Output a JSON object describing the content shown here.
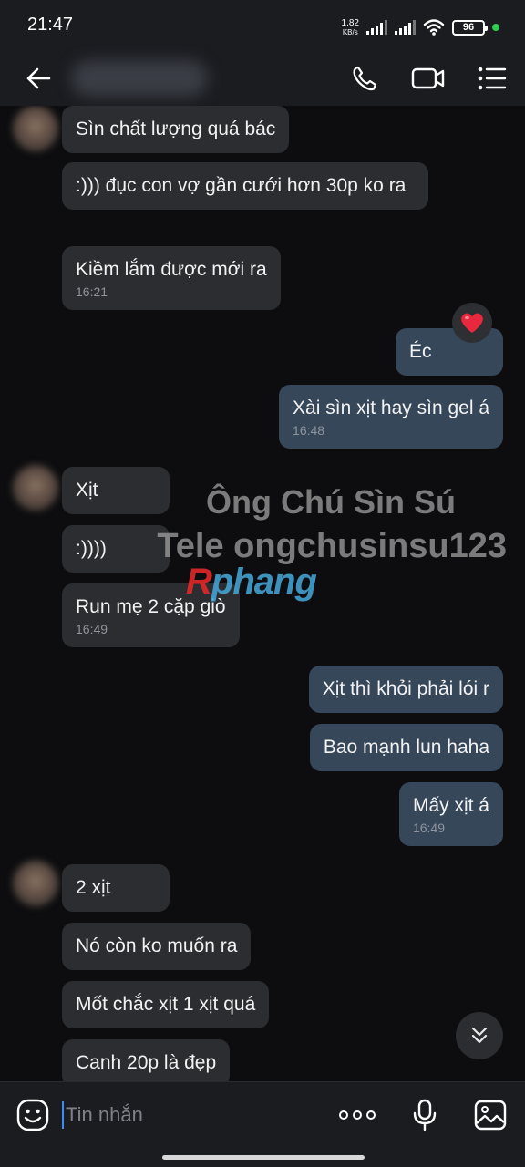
{
  "status_bar": {
    "time": "21:47",
    "net_speed_value": "1.82",
    "net_speed_unit": "KB/s",
    "battery": "96"
  },
  "header": {
    "contact_name": "",
    "icons": [
      "back-arrow-icon",
      "phone-icon",
      "video-call-icon",
      "menu-list-icon"
    ]
  },
  "messages": [
    {
      "side": "in",
      "text": "Sìn chất lượng quá bác"
    },
    {
      "side": "in",
      "text": ":))) đục con vợ gần cưới hơn 30p ko ra"
    },
    {
      "side": "in",
      "text": "Kiềm lắm được mới ra",
      "time": "16:21"
    },
    {
      "side": "out",
      "text": "Éc",
      "reaction": "heart"
    },
    {
      "side": "out",
      "text": "Xài sìn xịt hay sìn gel á",
      "time": "16:48"
    },
    {
      "side": "in",
      "text": "Xịt"
    },
    {
      "side": "in",
      "text": ":))))"
    },
    {
      "side": "in",
      "text": "Run mẹ 2 cặp giò",
      "time": "16:49"
    },
    {
      "side": "out",
      "text": "Xịt thì khỏi phải lói r"
    },
    {
      "side": "out",
      "text": "Bao mạnh lun haha"
    },
    {
      "side": "out",
      "text": "Mấy xịt á",
      "time": "16:49"
    },
    {
      "side": "in",
      "text": "2 xịt"
    },
    {
      "side": "in",
      "text": "Nó còn ko muốn ra"
    },
    {
      "side": "in",
      "text": "Mốt chắc xịt 1 xịt quá"
    },
    {
      "side": "in",
      "text": "Canh 20p là đẹp"
    }
  ],
  "watermark": {
    "line1": "Ông Chú Sìn Sú",
    "line2": "Tele ongchusinsu123",
    "brand_r": "R",
    "brand_rest": "phang"
  },
  "composer": {
    "placeholder": "Tin nhắn",
    "icons": [
      "emoji-icon",
      "more-icon",
      "microphone-icon",
      "image-icon"
    ]
  },
  "colors": {
    "background": "#0d0d0f",
    "incoming_bubble": "#2c2d31",
    "outgoing_bubble": "#37475a",
    "accent": "#3d8ef0",
    "reaction_heart": "#e8283c"
  }
}
